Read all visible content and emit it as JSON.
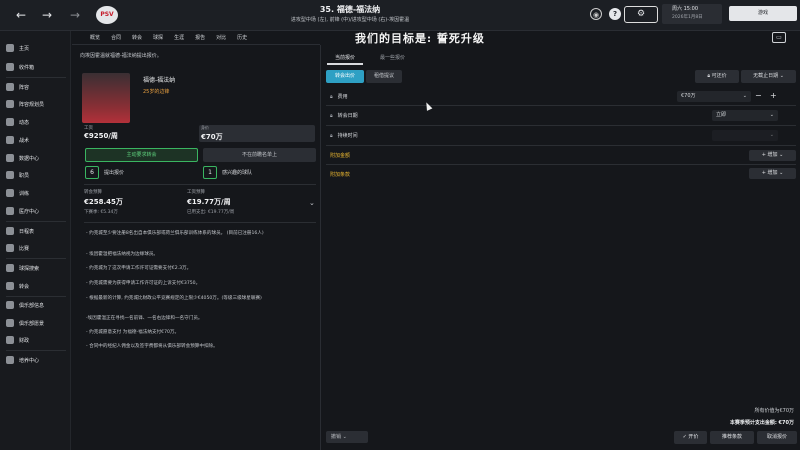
{
  "header": {
    "title": "35. 福德-福法纳",
    "subtitle": "进攻型中场 (左), 前锋 (中)/进攻型中场 (右)-埃因霍温",
    "date_day": "周六 15:00",
    "date_full": "2026年1月8日",
    "continue_label": "游戏",
    "logo_text": "PSV"
  },
  "sidebar": {
    "items": [
      "主页",
      "收件箱",
      "阵容",
      "阵容规划员",
      "动态",
      "战术",
      "数据中心",
      "职员",
      "训练",
      "医疗中心",
      "日程表",
      "比赛",
      "球探搜索",
      "转会",
      "俱乐部信息",
      "俱乐部愿景",
      "财政",
      "培养中心"
    ]
  },
  "subnav": {
    "items": [
      "概览",
      "合同",
      "转会",
      "球探",
      "生涯",
      "报告",
      "对比",
      "历史"
    ]
  },
  "offer": {
    "notice": "向埃因霍温就福德-福法纳提出报价。",
    "player_name": "福德-福法纳",
    "player_pos": "25岁的边锋",
    "wage_label": "工资",
    "wage_value": "€9250/周",
    "fee_label": "身价",
    "fee_value": "€70万",
    "active_btn": "主动要求转会",
    "shortlist_btn": "不在前瞻名单上",
    "offers_count": "6",
    "offers_label": "提出报价",
    "interest_count": "1",
    "interest_label": "感兴趣的球队",
    "budget_label": "转会预算",
    "budget_value": "€258.45万",
    "budget_sub": "下赛季: €5.34万",
    "wagebud_label": "工资预算",
    "wagebud_value": "€19.77万/周",
    "wagebud_sub": "已用支出: €19.77万/周",
    "notes": [
      "- 约克城至少要注册8名出自本俱乐部或荷兰俱乐部训练体系的球员。 (目前已注册16人)",
      "- 埃因霍温把福法纳视为边缘球员。",
      "- 约克城为了这次申请工作许可证需要支付€2.3万。",
      "- 约克城需要为获得申请工作许可证的上诉支付€3750。",
      "- 根据最新的计算, 约克城比财政公平竞赛规定的上限少€4050万。(等级三级球星联赛)",
      "-埃因霍温正在寻找一名前锋、一名右边锋和一名守门员。",
      "- 约克城愿意支付 为福德-福法纳支付€70万。",
      "- 合同中的经纪人佣金以及签字费都将从俱乐部转会预算中扣除。"
    ]
  },
  "overlay": {
    "text": "我们的目标是: 誓死升级"
  },
  "right": {
    "tab_current": "当前报价",
    "tab_latest": "最一些报价",
    "btn_transfer": "转会出价",
    "btn_loan": "租借提议",
    "btn_negotiable": "可还价",
    "btn_deadline": "无截止日期",
    "row_fee": "费用",
    "fee_value": "€70万",
    "row_date": "转会日期",
    "date_value": "立即",
    "row_duration": "持续时间",
    "duration_value": "",
    "add_fee": "附加金额",
    "add_clause": "附加条款",
    "add_btn": "+ 增加",
    "bottom_line1": "所有价值为€70万",
    "bottom_line2": "本赛季预计支出金额: €70万",
    "cancel_left": "撤销",
    "btn_negotiate": "开价",
    "btn_recommend": "推荐条款",
    "btn_cancel": "取消报价"
  }
}
